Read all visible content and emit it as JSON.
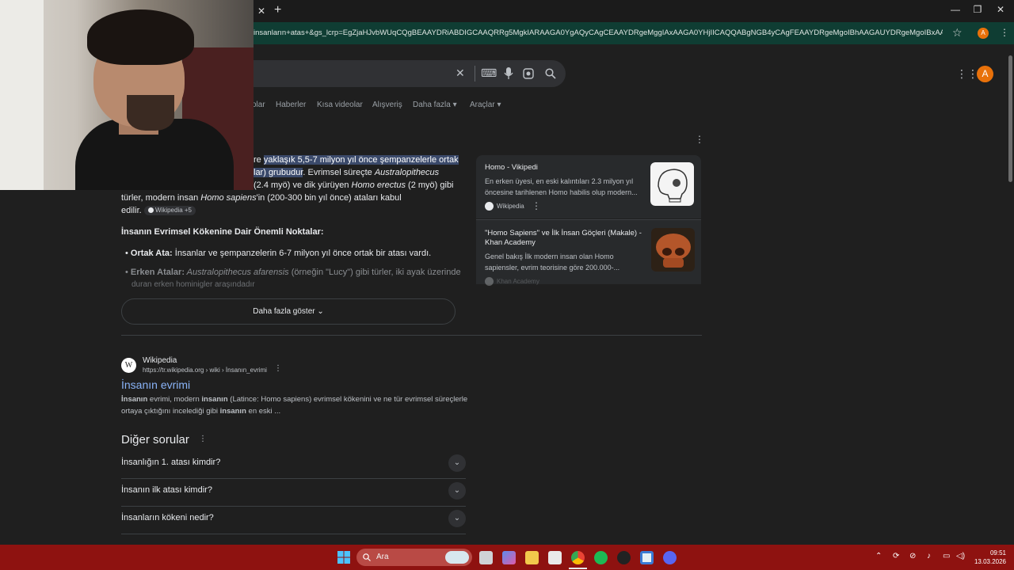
{
  "browser": {
    "new_tab": "+",
    "tab_close": "✕",
    "url": "insanların+atas+&gs_lcrp=EgZjaHJvbWUqCQgBEAAYDRiABDIGCAAQRRg5MgkIARAAGA0YgAQyCAgCEAAYDRgeMggIAxAAGA0YHjIICAQQABgNGB4yCAgFEAAYDRgeMgoIBhAAGAUYDRgeMgoIBxAAGAUYDRge...",
    "profile_letter": "A"
  },
  "search": {
    "tabs": [
      "olar",
      "Haberler",
      "Kısa videolar",
      "Alışveriş",
      "Daha fazla",
      "Araçlar"
    ],
    "avatar_letter": "A"
  },
  "overview": {
    "line1_pre": "re ",
    "line1_hl": "yaklaşık 5,5-7 milyon yıl önce şempanzelerle ortak",
    "line2_hl": "lar) grubudur",
    "line2_post": ". Evrimsel süreçte ",
    "line2_italic": "Australopithecus",
    "line3_pre": "(2.4 myö) ve dik yürüyen ",
    "line3_italic": "Homo erectus",
    "line3_post": " (2 myö) gibi",
    "line4_pre": "türler, modern insan ",
    "line4_italic": "Homo sapiens",
    "line4_post": "'in (200-300 bin yıl önce) ataları kabul",
    "line5": "edilir.",
    "chip": "Wikipedia +5",
    "heading": "İnsanın Evrimsel Kökenine Dair Önemli Noktalar:",
    "b1_label": "Ortak Ata:",
    "b1_text": " İnsanlar ve şempanzelerin 6-7 milyon yıl önce ortak bir atası vardı.",
    "b2_label": "Erken Atalar:",
    "b2_italic": " Australopithecus afarensis",
    "b2_text": " (örneğin \"Lucy\") gibi türler, iki ayak üzerinde",
    "b2_line2": "duran erken hominigler araşındadır",
    "more_button": "Daha fazla göster"
  },
  "side_cards": [
    {
      "title": "Homo - Vikipedi",
      "snippet1": "En erken üyesi, en eski kalıntıları 2.3 milyon yıl",
      "snippet2": "öncesine tarihlenen Homo habilis olup modern...",
      "source": "Wikipedia"
    },
    {
      "title1": "\"Homo Sapiens\" ve İlk İnsan Göçleri (Makale) -",
      "title2": "Khan Academy",
      "snippet1": "Genel bakış İlk modern insan olan Homo",
      "snippet2": "sapiensler, evrim teorisine göre 200.000-...",
      "source": "Khan Academy"
    }
  ],
  "result": {
    "site": "Wikipedia",
    "url": "https://tr.wikipedia.org › wiki › İnsanın_evrimi",
    "title": "İnsanın evrimi",
    "snippet1_b1": "İnsanın",
    "snippet1_t1": " evrimi, modern ",
    "snippet1_b2": "insanın",
    "snippet1_t2": " (Latince: Homo sapiens) evrimsel kökenini ve ne tür evrimsel süreçlerle",
    "snippet2_t1": "ortaya çıktığını incelediği gibi ",
    "snippet2_b1": "insanın",
    "snippet2_t2": " en eski ..."
  },
  "other_questions": {
    "heading": "Diğer sorular",
    "items": [
      "İnsanlığın 1. atası kimdir?",
      "İnsanın ilk atası kimdir?",
      "İnsanların kökeni nedir?"
    ]
  },
  "taskbar": {
    "search_label": "Ara",
    "time": "09:51",
    "date": "13.03.2026"
  },
  "colors": {
    "accent_orange": "#e8710a",
    "highlight": "#3b4a6b",
    "taskbar": "#8e1210",
    "addressbar": "#0f3d33"
  }
}
